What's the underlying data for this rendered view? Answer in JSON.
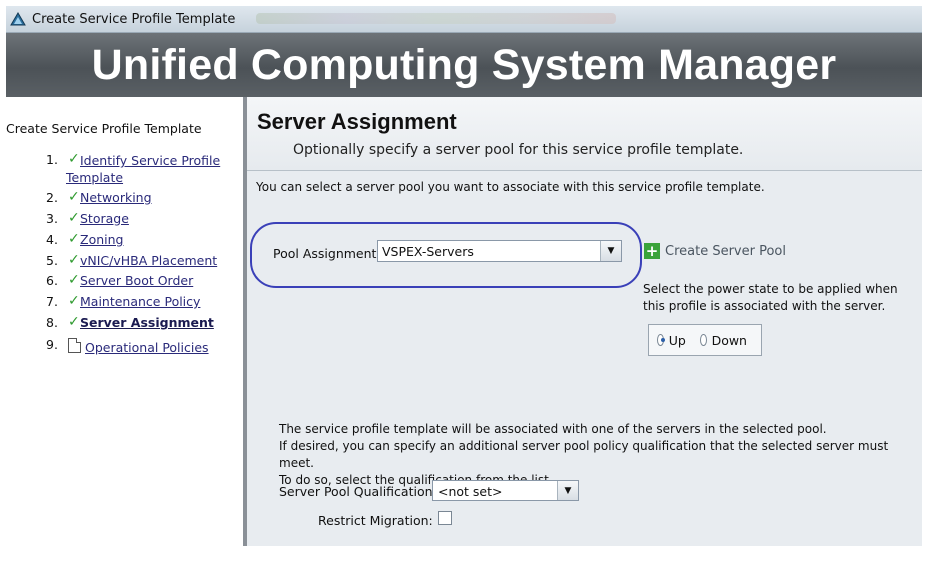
{
  "window": {
    "title": "Create Service Profile Template",
    "banner": "Unified Computing System Manager"
  },
  "nav": {
    "heading": "Create Service Profile Template",
    "steps": [
      {
        "num": "1.",
        "label_line1": "Identify Service Profile",
        "label_line2": "Template",
        "status": "done"
      },
      {
        "num": "2.",
        "label": "Networking",
        "status": "done"
      },
      {
        "num": "3.",
        "label": "Storage",
        "status": "done"
      },
      {
        "num": "4.",
        "label": "Zoning",
        "status": "done"
      },
      {
        "num": "5.",
        "label": "vNIC/vHBA Placement",
        "status": "done"
      },
      {
        "num": "6.",
        "label": "Server Boot Order",
        "status": "done"
      },
      {
        "num": "7.",
        "label": "Maintenance Policy",
        "status": "done"
      },
      {
        "num": "8.",
        "label": "Server Assignment",
        "status": "current"
      },
      {
        "num": "9.",
        "label": "Operational Policies",
        "status": "pending"
      }
    ]
  },
  "main": {
    "title": "Server Assignment",
    "subtitle": "Optionally specify a server pool for this service profile template.",
    "intro": "You can select a server pool you want to associate with this service profile template.",
    "pool_assignment": {
      "label": "Pool Assignment:",
      "value": "VSPEX-Servers"
    },
    "create_pool_label": "Create Server Pool",
    "power_state": {
      "text": "Select the power state to be applied when this profile is associated with the server.",
      "options": [
        "Up",
        "Down"
      ],
      "selected": "Up"
    },
    "qualification": {
      "line1": "The service profile template will be associated with one of the servers in the selected pool.",
      "line2": "If desired, you can specify an additional server pool policy qualification that the selected server must meet.",
      "line3": "To do so, select the qualification from the list.",
      "label": "Server Pool Qualification:",
      "value": "<not set>"
    },
    "restrict_migration": {
      "label": "Restrict Migration:",
      "checked": false
    }
  },
  "colors": {
    "check_green": "#2e9a2e",
    "highlight_oval": "#3a40b8",
    "link": "#2a2a7a"
  }
}
